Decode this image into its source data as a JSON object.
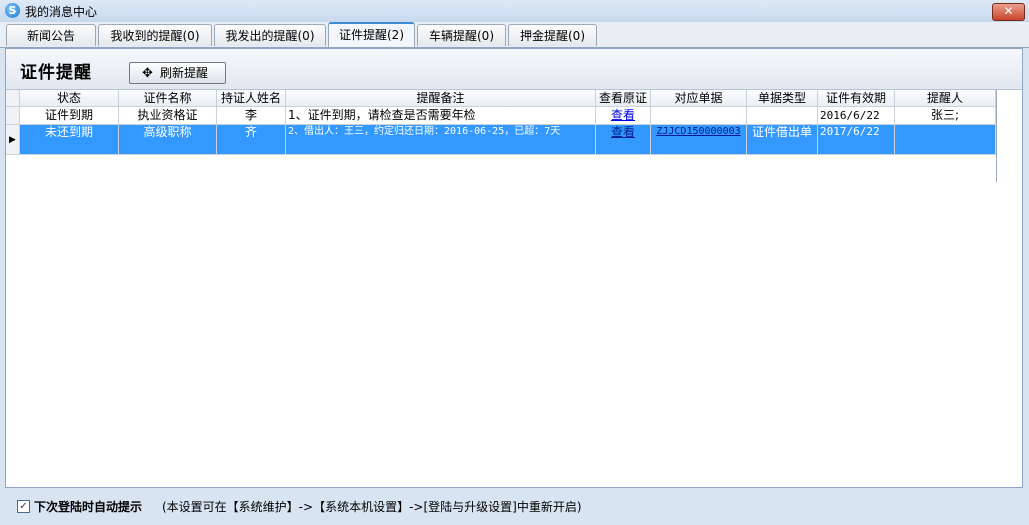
{
  "window": {
    "title": "我的消息中心",
    "close_label": "✕"
  },
  "tabs": [
    {
      "label": "新闻公告"
    },
    {
      "label": "我收到的提醒(0)"
    },
    {
      "label": "我发出的提醒(0)"
    },
    {
      "label": "证件提醒(2)"
    },
    {
      "label": "车辆提醒(0)"
    },
    {
      "label": "押金提醒(0)"
    }
  ],
  "active_tab": "证件提醒(2)",
  "panel": {
    "title": "证件提醒",
    "refresh_label": "刷新提醒",
    "refresh_icon": "refresh-icon"
  },
  "table": {
    "columns": [
      "状态",
      "证件名称",
      "持证人姓名",
      "提醒备注",
      "查看原证",
      "对应单据",
      "单据类型",
      "证件有效期",
      "提醒人"
    ],
    "rows": [
      {
        "status": "证件到期",
        "cert_name": "执业资格证",
        "holder": "李",
        "note": "1、证件到期，请检查是否需要年检",
        "view": "查看",
        "doc_no": "",
        "doc_type": "",
        "valid_until": "2016/6/22",
        "reminder": "张三;"
      },
      {
        "status": "未还到期",
        "cert_name": "高级职称",
        "holder": "齐",
        "note": "2、借出人：王三，约定归还日期：2016-06-25，已超：7天",
        "view": "查看",
        "doc_no": "ZJJCD150000003",
        "doc_type": "证件借出单",
        "valid_until": "2017/6/22",
        "reminder": ""
      }
    ],
    "selected_row": 2
  },
  "footer": {
    "checkbox_checked": true,
    "label": "下次登陆时自动提示",
    "note": "(本设置可在【系统维护】->【系统本机设置】->[登陆与升级设置]中重新开启)"
  },
  "colors": {
    "selection": "#3399ff",
    "link": "#0000ee",
    "tab_accent": "#3c8cd6"
  }
}
